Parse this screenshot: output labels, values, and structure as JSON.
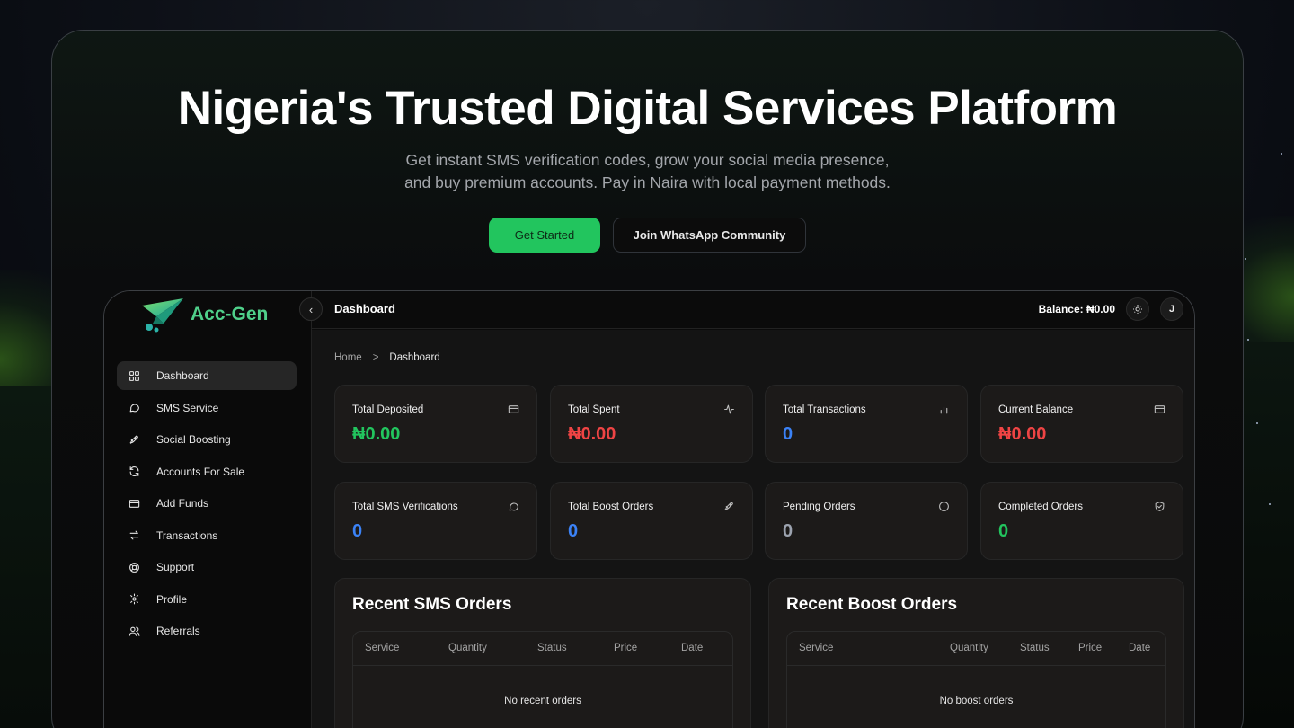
{
  "hero": {
    "title": "Nigeria's Trusted Digital Services Platform",
    "subtitle_line1": "Get instant SMS verification codes, grow your social media presence,",
    "subtitle_line2": "and buy premium accounts. Pay in Naira with local payment methods.",
    "primary_button": "Get Started",
    "secondary_button": "Join WhatsApp Community"
  },
  "app": {
    "logo_text": "Acc-Gen",
    "collapse_icon": "chevron-left-icon",
    "sidebar": {
      "items": [
        {
          "label": "Dashboard",
          "icon": "grid-icon",
          "active": true
        },
        {
          "label": "SMS Service",
          "icon": "message-icon",
          "active": false
        },
        {
          "label": "Social Boosting",
          "icon": "rocket-icon",
          "active": false
        },
        {
          "label": "Accounts For Sale",
          "icon": "refresh-icon",
          "active": false
        },
        {
          "label": "Add Funds",
          "icon": "credit-card-icon",
          "active": false
        },
        {
          "label": "Transactions",
          "icon": "arrows-icon",
          "active": false
        },
        {
          "label": "Support",
          "icon": "lifebuoy-icon",
          "active": false
        },
        {
          "label": "Profile",
          "icon": "gear-icon",
          "active": false
        },
        {
          "label": "Referrals",
          "icon": "users-icon",
          "active": false
        }
      ]
    },
    "topbar": {
      "title": "Dashboard",
      "balance": "Balance: ₦0.00",
      "avatar_initial": "J"
    },
    "breadcrumb": {
      "home": "Home",
      "separator": ">",
      "current": "Dashboard"
    },
    "stats": [
      {
        "label": "Total Deposited",
        "value": "₦0.00",
        "color": "#22c55e",
        "icon": "credit-card-icon"
      },
      {
        "label": "Total Spent",
        "value": "₦0.00",
        "color": "#ef4444",
        "icon": "activity-icon"
      },
      {
        "label": "Total Transactions",
        "value": "0",
        "color": "#3b82f6",
        "icon": "bar-chart-icon"
      },
      {
        "label": "Current Balance",
        "value": "₦0.00",
        "color": "#ef4444",
        "icon": "credit-card-icon"
      },
      {
        "label": "Total SMS Verifications",
        "value": "0",
        "color": "#3b82f6",
        "icon": "message-icon"
      },
      {
        "label": "Total Boost Orders",
        "value": "0",
        "color": "#3b82f6",
        "icon": "rocket-icon"
      },
      {
        "label": "Pending Orders",
        "value": "0",
        "color": "#9ca3af",
        "icon": "alert-circle-icon"
      },
      {
        "label": "Completed Orders",
        "value": "0",
        "color": "#22c55e",
        "icon": "shield-check-icon"
      }
    ],
    "sms_orders": {
      "title": "Recent SMS Orders",
      "columns": [
        "Service",
        "Quantity",
        "Status",
        "Price",
        "Date"
      ],
      "empty": "No recent orders"
    },
    "boost_orders": {
      "title": "Recent Boost Orders",
      "columns": [
        "Service",
        "Quantity",
        "Status",
        "Price",
        "Date"
      ],
      "empty": "No boost orders"
    }
  }
}
